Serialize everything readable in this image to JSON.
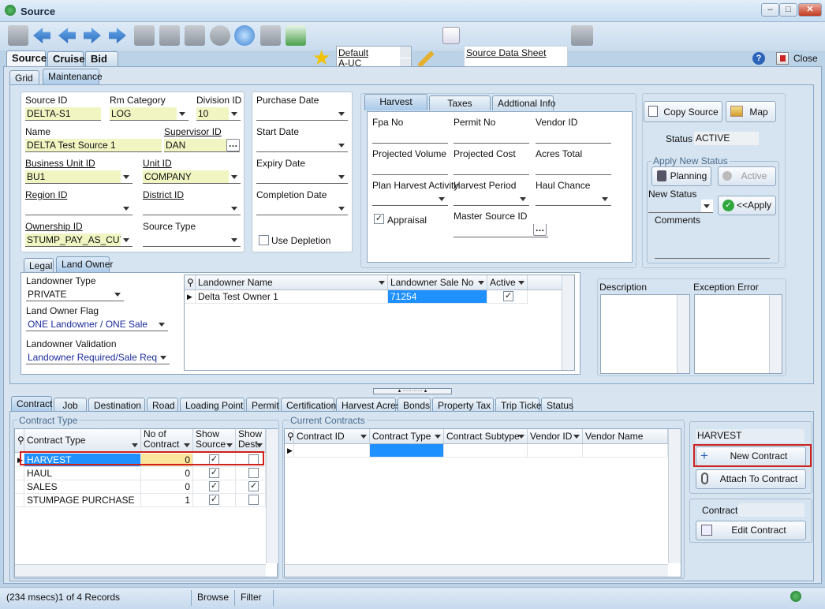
{
  "window": {
    "title": "Source",
    "close_label": "Close"
  },
  "toolbar": {
    "layout_list": [
      "Default",
      "A-UC",
      "Default"
    ],
    "report_name": "Source Data Sheet"
  },
  "main_tabs": [
    "Source",
    "Cruise",
    "Bid"
  ],
  "view_tabs": [
    "Grid",
    "Maintenance"
  ],
  "source": {
    "source_id_label": "Source ID",
    "source_id": "DELTA-S1",
    "rm_category_label": "Rm Category",
    "rm_category": "LOG",
    "division_id_label": "Division ID",
    "division_id": "10",
    "name_label": "Name",
    "name": "DELTA Test Source 1",
    "supervisor_id_label": "Supervisor ID",
    "supervisor_id": "DAN",
    "business_unit_id_label": "Business Unit ID",
    "business_unit_id": "BU1",
    "unit_id_label": "Unit ID",
    "unit_id": "COMPANY",
    "region_id_label": "Region ID",
    "district_id_label": "District ID",
    "ownership_id_label": "Ownership ID",
    "ownership_id": "STUMP_PAY_AS_CUT",
    "source_type_label": "Source Type"
  },
  "dates": {
    "purchase_date": "Purchase Date",
    "start_date": "Start Date",
    "expiry_date": "Expiry Date",
    "completion_date": "Completion Date",
    "use_depletion": "Use Depletion"
  },
  "harvest_tabs": [
    "Harvest",
    "Taxes",
    "Addtional Info"
  ],
  "harvest": {
    "fpa_no": "Fpa No",
    "permit_no": "Permit No",
    "vendor_id": "Vendor ID",
    "projected_volume": "Projected Volume",
    "projected_cost": "Projected Cost",
    "acres_total": "Acres Total",
    "plan_harvest_activity": "Plan Harvest Activity",
    "harvest_period": "Harvest Period",
    "haul_chance": "Haul Chance",
    "appraisal": "Appraisal",
    "master_source_id": "Master Source ID"
  },
  "side": {
    "copy_source": "Copy Source",
    "map": "Map",
    "status_label": "Status",
    "status_value": "ACTIVE",
    "apply_new_status": "Apply New Status",
    "planning": "Planning",
    "active": "Active",
    "new_status": "New Status",
    "apply": "<<Apply",
    "comments": "Comments"
  },
  "legal_tabs": [
    "Legal",
    "Land Owner"
  ],
  "landowner": {
    "type_label": "Landowner Type",
    "type_value": "PRIVATE",
    "flag_label": "Land Owner Flag",
    "flag_value": "ONE Landowner / ONE Sale",
    "validation_label": "Landowner Validation",
    "validation_value": "Landowner Required/Sale Require"
  },
  "landowner_grid": {
    "headers": [
      "Landowner Name",
      "Landowner Sale No",
      "Active"
    ],
    "rows": [
      {
        "name": "Delta Test Owner 1",
        "sale_no": "71254",
        "active": "✓"
      }
    ]
  },
  "desc": {
    "description": "Description",
    "exception_error": "Exception Error"
  },
  "bottom_tabs": [
    "Contract",
    "Job",
    "Destination",
    "Road",
    "Loading Point",
    "Permit",
    "Certification",
    "Harvest Acres",
    "Bonds",
    "Property Tax",
    "Trip Ticket",
    "Status"
  ],
  "contract_type": {
    "title": "Contract Type",
    "headers": [
      "Contract Type",
      "No of Contract",
      "Show Source",
      "Show Dest."
    ],
    "rows": [
      {
        "type": "HARVEST",
        "count": "0",
        "src": "✓",
        "dest": ""
      },
      {
        "type": "HAUL",
        "count": "0",
        "src": "✓",
        "dest": ""
      },
      {
        "type": "SALES",
        "count": "0",
        "src": "✓",
        "dest": "✓"
      },
      {
        "type": "STUMPAGE PURCHASE",
        "count": "1",
        "src": "✓",
        "dest": ""
      }
    ]
  },
  "current_contracts": {
    "title": "Current Contracts",
    "headers": [
      "Contract ID",
      "Contract Type",
      "Contract Subtype",
      "Vendor ID",
      "Vendor Name"
    ]
  },
  "contract_actions": {
    "selected_type": "HARVEST",
    "new_contract": "New Contract",
    "attach": "Attach To Contract",
    "contract_label": "Contract",
    "edit_contract": "Edit Contract"
  },
  "statusbar": {
    "records": "(234 msecs)1 of 4 Records",
    "mode": "Browse",
    "filter": "Filter"
  },
  "colors": {
    "accent_red": "#d0201a",
    "field_yellow": "#f1f5c2",
    "selected_blue": "#1e90ff"
  }
}
